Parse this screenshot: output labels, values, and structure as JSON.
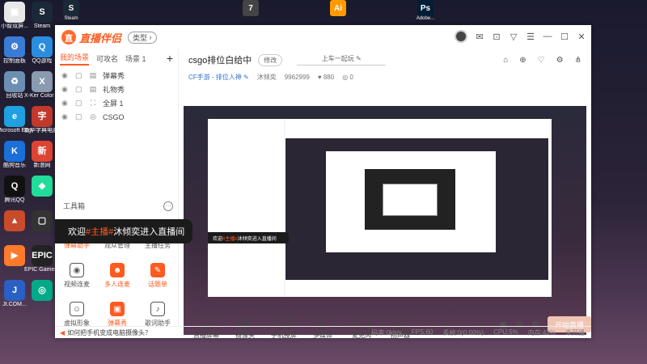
{
  "desktop": {
    "left_icons": [
      {
        "label": "小智双屏...",
        "icon": "widget-icon",
        "color": "#e8e8e8",
        "glyph": "▣"
      },
      {
        "label": "控制面板",
        "icon": "control-panel-icon",
        "color": "#3a7bd5",
        "glyph": "⚙"
      },
      {
        "label": "回收站",
        "icon": "recycle-bin-icon",
        "color": "#6b8fb0",
        "glyph": "♻"
      },
      {
        "label": "Microsoft Edge",
        "icon": "edge-icon",
        "color": "#1fa0e0",
        "glyph": "e"
      },
      {
        "label": "酷狗音乐",
        "icon": "kugou-icon",
        "color": "#1a6fd8",
        "glyph": "K"
      },
      {
        "label": "腾讯QQ",
        "icon": "qq-icon",
        "color": "#111",
        "glyph": "Q"
      },
      {
        "label": "",
        "icon": "app-icon",
        "color": "#c84b2b",
        "glyph": "▲"
      },
      {
        "label": "",
        "icon": "app-icon",
        "color": "#ff7a2b",
        "glyph": "▶"
      },
      {
        "label": "Jt.COM...",
        "icon": "app-icon",
        "color": "#2a5fc4",
        "glyph": "J"
      }
    ],
    "second_col_icons": [
      {
        "label": "Steam",
        "icon": "steam-icon",
        "color": "#1b2838",
        "glyph": "S"
      },
      {
        "label": "QQ游戏",
        "icon": "qq-game-icon",
        "color": "#2b8de0",
        "glyph": "Q"
      },
      {
        "label": "X-Ker Color Assistant",
        "icon": "app-icon",
        "color": "#8a9bb0",
        "glyph": "X"
      },
      {
        "label": "新华字典电脑版",
        "icon": "app-icon",
        "color": "#c0392b",
        "glyph": "字"
      },
      {
        "label": "新浪网",
        "icon": "app-icon",
        "color": "#d43",
        "glyph": "新"
      },
      {
        "label": "",
        "icon": "app-icon",
        "color": "#2d9",
        "glyph": "◆"
      },
      {
        "label": "",
        "icon": "app-icon",
        "color": "#333",
        "glyph": "▢"
      },
      {
        "label": "EPIC Games Launcher",
        "icon": "epic-icon",
        "color": "#222",
        "glyph": "EPIC"
      },
      {
        "label": "",
        "icon": "app-icon",
        "color": "#0a8",
        "glyph": "◎"
      }
    ],
    "top_apps": [
      {
        "label": "Steam",
        "icon": "steam-icon",
        "color": "#1b2838",
        "glyph": "S"
      },
      {
        "label": "",
        "icon": "app-icon",
        "color": "#444",
        "glyph": "7"
      },
      {
        "label": "",
        "icon": "illustrator-icon",
        "color": "#ff9a00",
        "glyph": "Ai"
      },
      {
        "label": "Adobe...",
        "icon": "photoshop-icon",
        "color": "#001e36",
        "glyph": "Ps"
      }
    ]
  },
  "app": {
    "logo_text": "直播伴侣",
    "type_button": "类型",
    "window_controls": [
      "✉",
      "⊡",
      "▽",
      "☰",
      "—",
      "☐",
      "✕"
    ],
    "scene_tabs": [
      "我的场景",
      "可攻名",
      "场景 1"
    ],
    "sources": [
      {
        "name": "弹幕秀",
        "kind": "▤"
      },
      {
        "name": "礼物秀",
        "kind": "▤"
      },
      {
        "name": "全屏 1",
        "kind": "⛶"
      },
      {
        "name": "CSGO",
        "kind": "◎"
      }
    ],
    "tools_title": "工具箱",
    "tools": [
      {
        "label": "弹幕助手",
        "hot": true,
        "glyph": "▤"
      },
      {
        "label": "观众管理",
        "hot": false,
        "glyph": "♙"
      },
      {
        "label": "主播任务",
        "hot": false,
        "glyph": "☑"
      },
      {
        "label": "视频连麦",
        "hot": false,
        "glyph": "◉"
      },
      {
        "label": "多人连麦",
        "hot": true,
        "glyph": "☻"
      },
      {
        "label": "话题单",
        "hot": true,
        "glyph": "✎"
      },
      {
        "label": "虚拟形象",
        "hot": false,
        "glyph": "☺"
      },
      {
        "label": "弹幕秀",
        "hot": true,
        "glyph": "▣"
      },
      {
        "label": "歌词助手",
        "hot": false,
        "glyph": "♪"
      }
    ],
    "toast": {
      "prefix": "欢迎",
      "highlight": "#主播#",
      "suffix": "沐倾奕进入直播间"
    },
    "room": {
      "title": "csgo排位白给中",
      "edit_label": "修改",
      "slogan": "上车一起玩",
      "category": "CF手游 - 排位人神",
      "room_id_label": "沐倾奕",
      "room_id": "9962999",
      "fans": "880",
      "likes": "0"
    },
    "bottom_tools": [
      {
        "label": "直播屏幕",
        "glyph": "▭"
      },
      {
        "label": "摄像头",
        "glyph": "◉"
      },
      {
        "label": "手机投屏",
        "glyph": "▯"
      },
      {
        "label": "多媒体",
        "glyph": "▶"
      },
      {
        "label": "麦克风",
        "glyph": "♪"
      },
      {
        "label": "扬声器",
        "glyph": "◁"
      }
    ],
    "live_button": "开始直播",
    "status": {
      "tip": "如何把手机变成电脑摄像头？",
      "bitrate": "码率:0kb/s",
      "fps": "FPS:60",
      "drop": "丢帧:0(0.00%)",
      "cpu": "CPU:5%",
      "mem": "内存:42%",
      "live_state": "未开播"
    }
  }
}
